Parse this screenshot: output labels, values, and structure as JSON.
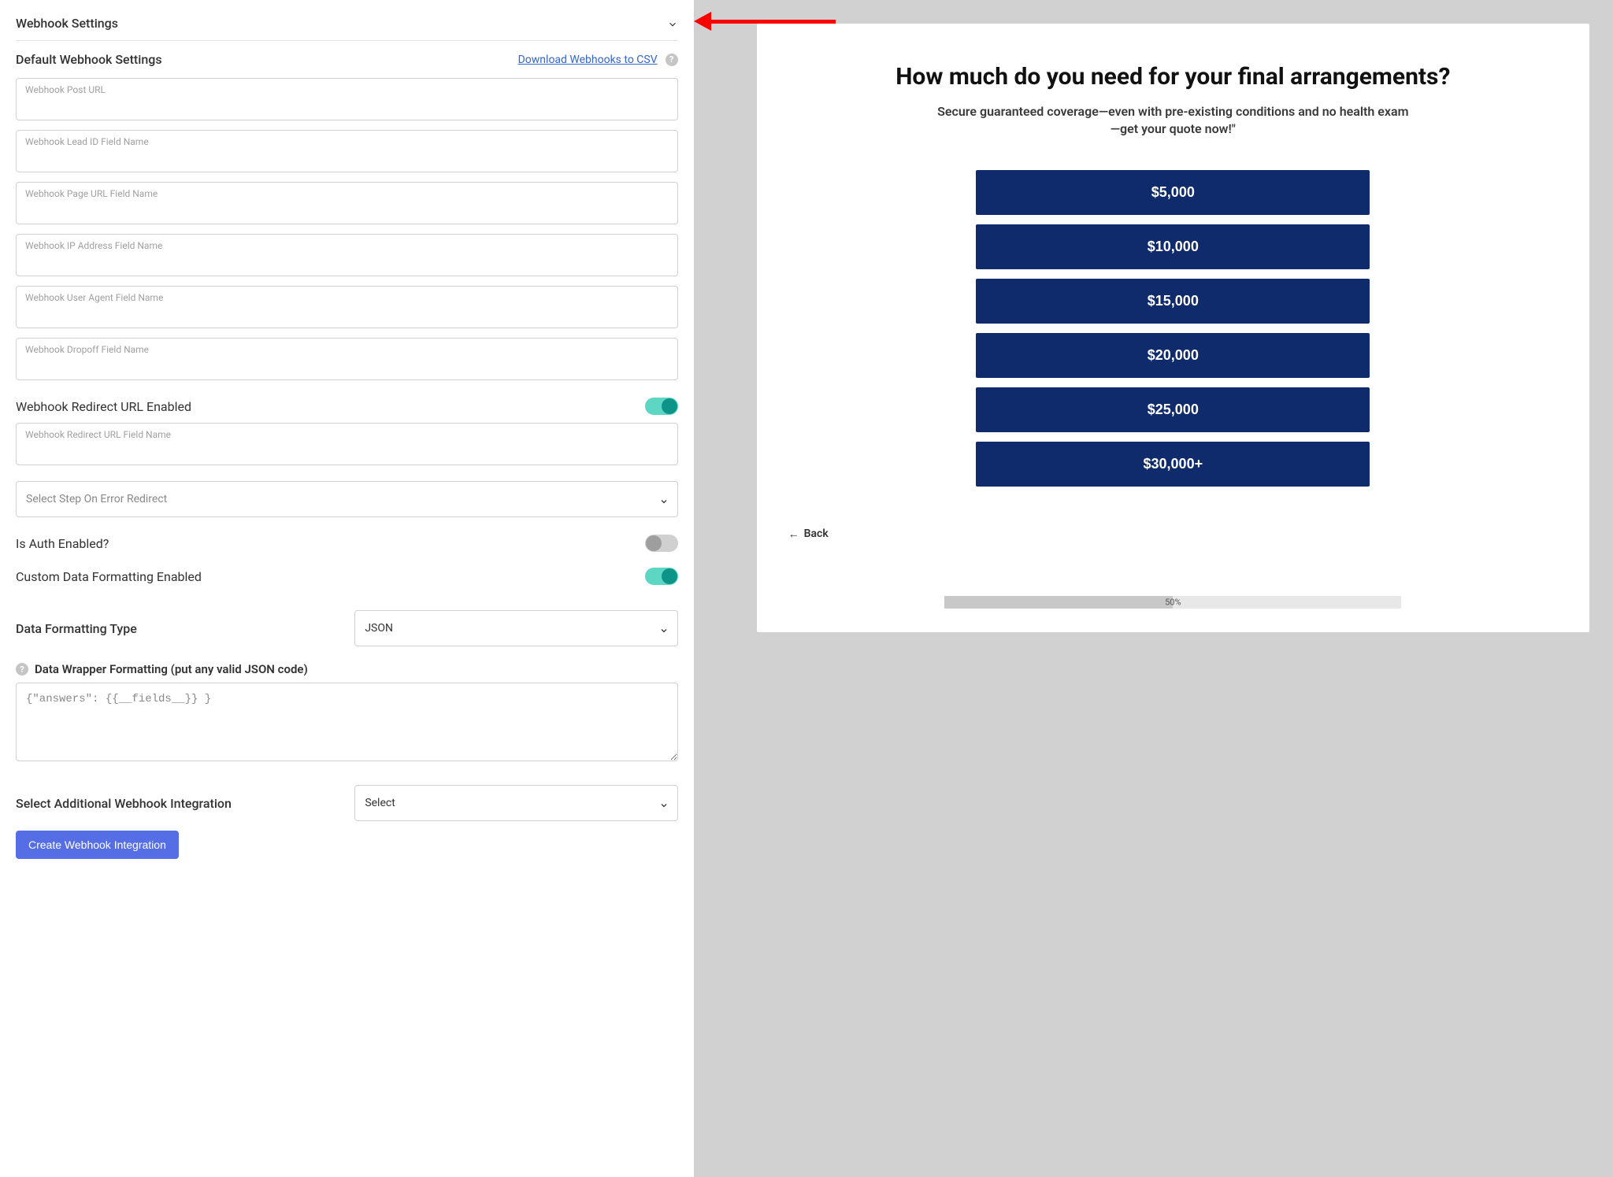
{
  "leftPanel": {
    "accordionTitle": "Webhook Settings",
    "defaultSection": {
      "label": "Default Webhook Settings",
      "downloadLink": "Download Webhooks to CSV"
    },
    "inputs": {
      "postUrl": {
        "placeholder": "Webhook Post URL",
        "value": ""
      },
      "leadId": {
        "placeholder": "Webhook Lead ID Field Name",
        "value": ""
      },
      "pageUrl": {
        "placeholder": "Webhook Page URL Field Name",
        "value": ""
      },
      "ipAddress": {
        "placeholder": "Webhook IP Address Field Name",
        "value": ""
      },
      "userAgent": {
        "placeholder": "Webhook User Agent Field Name",
        "value": ""
      },
      "dropoff": {
        "placeholder": "Webhook Dropoff Field Name",
        "value": ""
      },
      "redirectUrl": {
        "placeholder": "Webhook Redirect URL Field Name",
        "value": ""
      }
    },
    "toggles": {
      "redirectEnabled": {
        "label": "Webhook Redirect URL Enabled",
        "on": true
      },
      "authEnabled": {
        "label": "Is Auth Enabled?",
        "on": false
      },
      "customFormatting": {
        "label": "Custom Data Formatting Enabled",
        "on": true
      }
    },
    "selects": {
      "errorRedirect": {
        "placeholder": "Select Step On Error Redirect",
        "value": ""
      },
      "formatType": {
        "label": "Data Formatting Type",
        "value": "JSON"
      },
      "additionalIntegration": {
        "label": "Select Additional Webhook Integration",
        "value": "Select"
      }
    },
    "wrapper": {
      "label": "Data Wrapper Formatting (put any valid JSON code)",
      "value": "{\"answers\": {{__fields__}} }"
    },
    "createBtn": "Create Webhook Integration"
  },
  "preview": {
    "title": "How much do you need for your final arrangements?",
    "subtitle": "Secure guaranteed coverage—even with pre-existing conditions and no health exam—get your quote now!\"",
    "options": [
      "$5,000",
      "$10,000",
      "$15,000",
      "$20,000",
      "$25,000",
      "$30,000+"
    ],
    "backLabel": "Back",
    "progress": {
      "percent": 50,
      "label": "50%"
    }
  }
}
